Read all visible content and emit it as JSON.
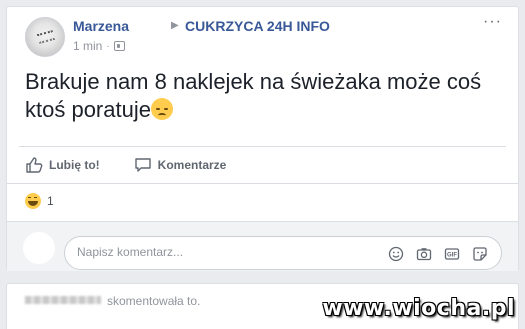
{
  "post": {
    "author": "Marzena",
    "arrow": "▶",
    "group": "CUKRZYCA 24H INFO",
    "time": "1 min",
    "dot": "·",
    "menu": "···",
    "text": "Brakuje nam 8 naklejek na świeżaka może coś ktoś poratuje"
  },
  "actions": {
    "like_label": "Lubię to!",
    "comment_label": "Komentarze"
  },
  "reactions": {
    "count": "1"
  },
  "comment_box": {
    "placeholder": "Napisz komentarz..."
  },
  "next_item": {
    "action_text": "skomentowała to."
  },
  "watermark": "www.wiocha.pl",
  "icons": {
    "like": "thumbs-up-icon",
    "comment": "speech-bubble-icon",
    "emoji": "smiley-icon",
    "camera": "camera-icon",
    "gif": "gif-icon",
    "sticker": "sticker-icon",
    "audience": "friends-audience-icon"
  }
}
